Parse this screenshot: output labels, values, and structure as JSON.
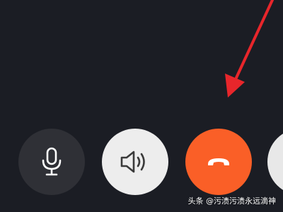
{
  "colors": {
    "background": "#1b1d24",
    "mic_button": "#2f3036",
    "speaker_button": "#ededed",
    "hangup_button": "#fa5f27",
    "annotation_arrow": "#e8262b"
  },
  "controls": {
    "buttons": [
      {
        "icon": "microphone-icon"
      },
      {
        "icon": "speaker-icon"
      },
      {
        "icon": "hang-up-phone-icon"
      },
      {
        "icon": ""
      }
    ]
  },
  "watermark": {
    "text": "头条 @污渍污渍永远滴神"
  }
}
